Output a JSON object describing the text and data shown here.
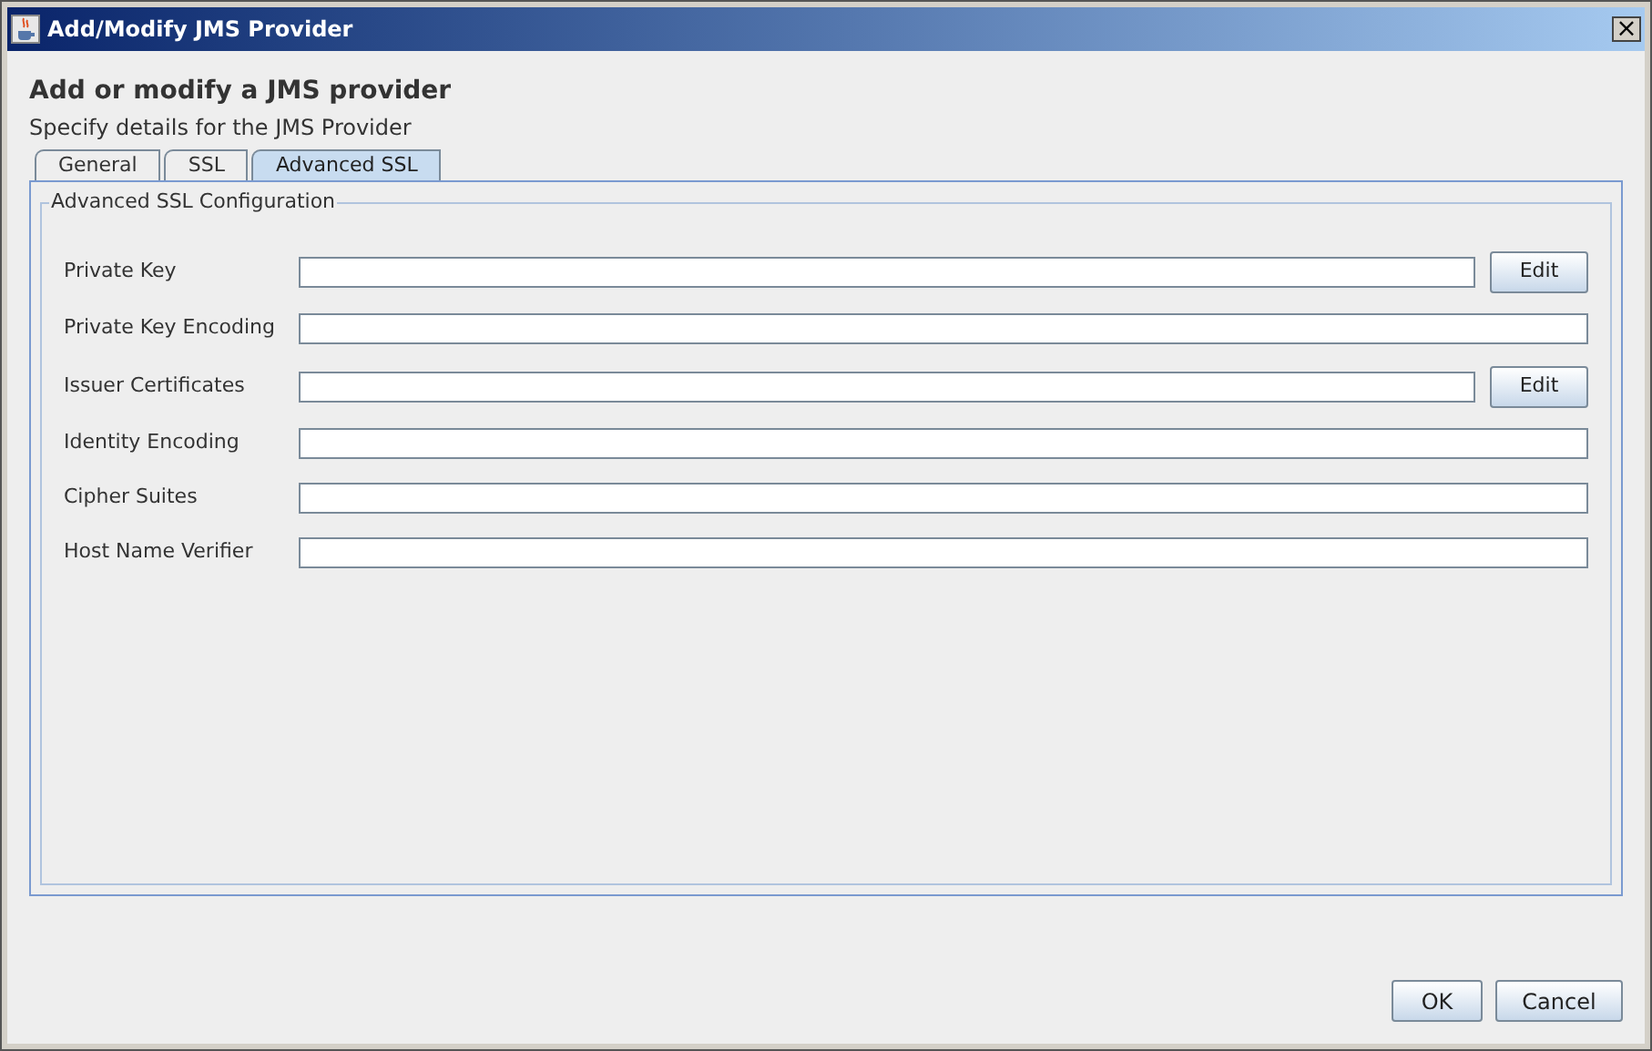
{
  "window": {
    "title": "Add/Modify JMS Provider",
    "close": "×"
  },
  "heading": "Add or modify a JMS provider",
  "subtitle": "Specify details for the JMS Provider",
  "tabs": [
    {
      "label": "General",
      "selected": false
    },
    {
      "label": "SSL",
      "selected": false
    },
    {
      "label": "Advanced SSL",
      "selected": true
    }
  ],
  "group": {
    "title": "Advanced SSL Configuration",
    "fields": [
      {
        "label": "Private Key",
        "kind": "with_button",
        "button": "Edit"
      },
      {
        "label": "Private Key Encoding",
        "kind": "plain"
      },
      {
        "label": "Issuer Certificates",
        "kind": "with_button",
        "button": "Edit"
      },
      {
        "label": "Identity Encoding",
        "kind": "plain"
      },
      {
        "label": "Cipher Suites",
        "kind": "plain"
      },
      {
        "label": "Host Name Verifier",
        "kind": "plain"
      }
    ]
  },
  "buttons": [
    "OK",
    "Cancel"
  ]
}
